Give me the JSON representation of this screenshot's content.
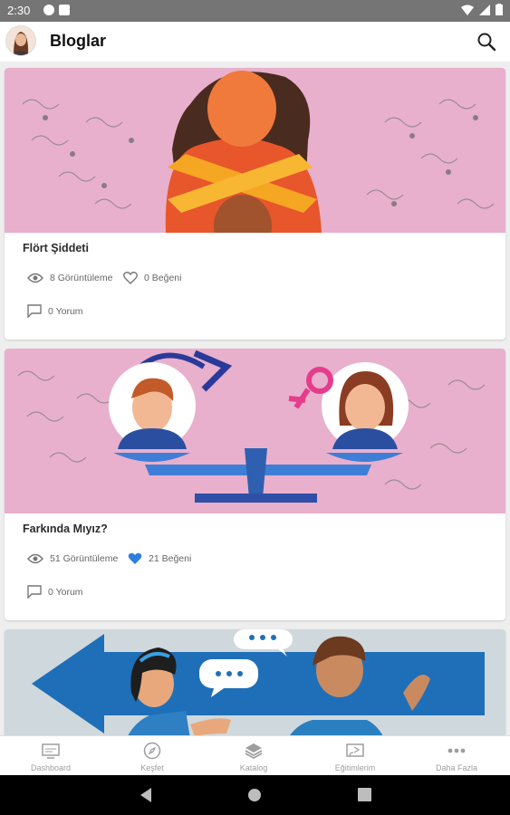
{
  "status_bar": {
    "time": "2:30"
  },
  "app_bar": {
    "title": "Bloglar"
  },
  "posts": [
    {
      "title": "Flört Şiddeti",
      "views": "8 Görüntüleme",
      "likes": "0 Beğeni",
      "comments": "0 Yorum",
      "liked": false
    },
    {
      "title": "Farkında Mıyız?",
      "views": "51 Görüntüleme",
      "likes": "21 Beğeni",
      "comments": "0 Yorum",
      "liked": true
    },
    {
      "title": "",
      "views": "",
      "likes": "",
      "comments": "",
      "liked": false
    }
  ],
  "bottom_nav": [
    {
      "label": "Dashboard",
      "icon": "dashboard-icon"
    },
    {
      "label": "Keşfet",
      "icon": "compass-icon"
    },
    {
      "label": "Katalog",
      "icon": "layers-icon"
    },
    {
      "label": "Eğitimlerim",
      "icon": "cast-icon"
    },
    {
      "label": "Daha Fazla",
      "icon": "more-icon"
    }
  ],
  "colors": {
    "card1_bg": "#e8b0cc",
    "card2_bg": "#e8b0cc",
    "card3_bg": "#cfd8dc",
    "like_active": "#2f7fe0",
    "icon_gray": "#777777"
  }
}
